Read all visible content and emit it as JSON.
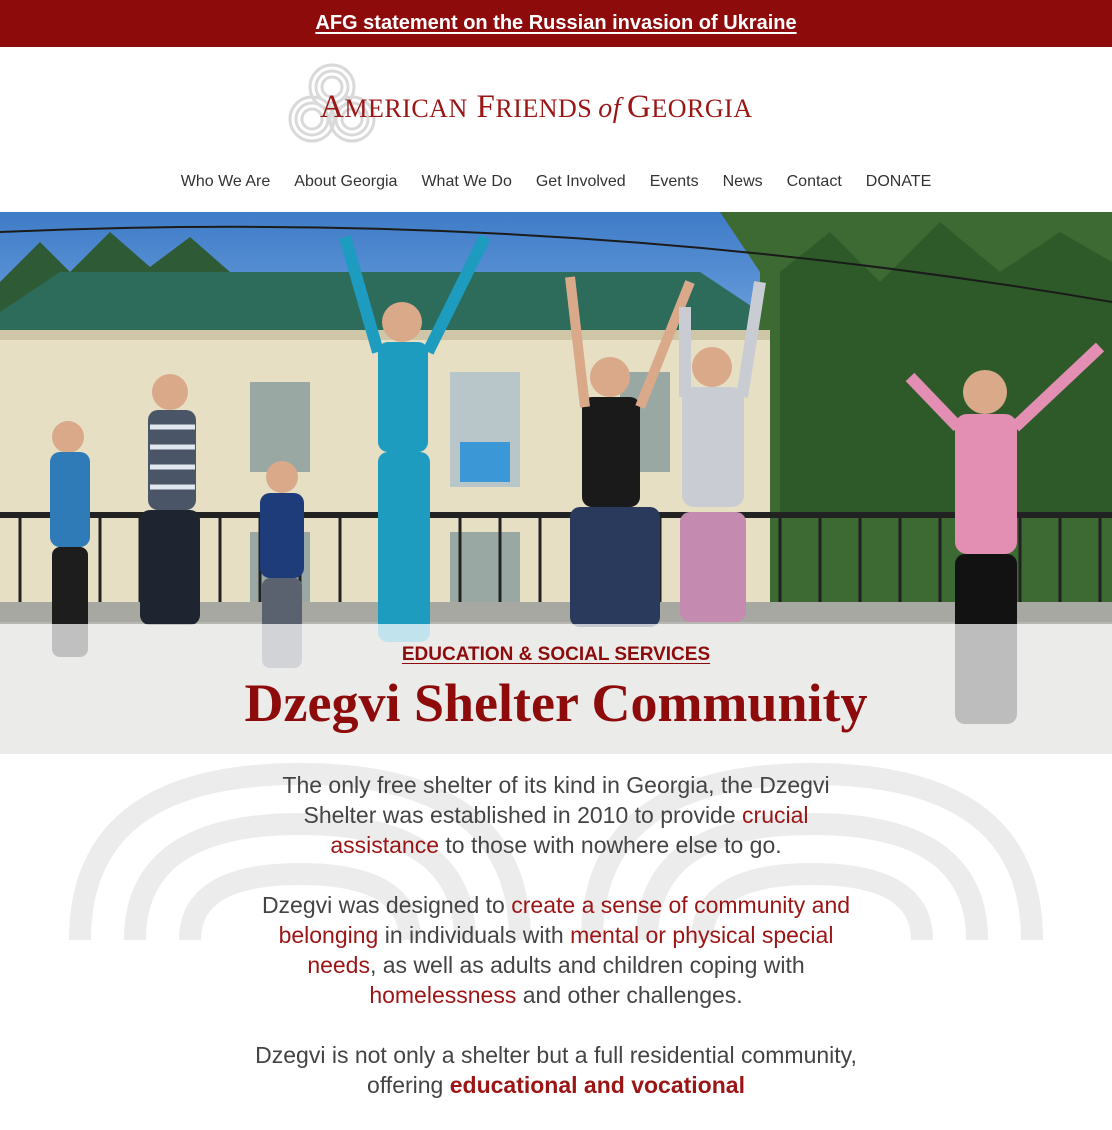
{
  "banner": {
    "link_text": "AFG statement on the Russian invasion of Ukraine"
  },
  "logo": {
    "icon": "knot-logo-icon",
    "word1_cap": "A",
    "word1_rest": "MERICAN",
    "word2_cap": "F",
    "word2_rest": "RIENDS",
    "of": "of",
    "word3_cap": "G",
    "word3_rest": "EORGIA"
  },
  "nav": {
    "items": [
      {
        "label": "Who We Are"
      },
      {
        "label": "About Georgia"
      },
      {
        "label": "What We Do"
      },
      {
        "label": "Get Involved"
      },
      {
        "label": "Events"
      },
      {
        "label": "News"
      },
      {
        "label": "Contact"
      },
      {
        "label": "DONATE"
      }
    ]
  },
  "hero": {
    "kicker": "EDUCATION & SOCIAL SERVICES",
    "title": "Dzegvi Shelter Community"
  },
  "content": {
    "p1": {
      "t1": "The only free shelter of its kind in Georgia, the Dzegvi Shelter was established in 2010 to provide ",
      "h1": "crucial assistance",
      "t2": " to those with nowhere else to go."
    },
    "p2": {
      "t1": "Dzegvi was designed to ",
      "h1": "create a sense of community and belonging",
      "t2": " in individuals with ",
      "h2": "mental or physical special needs",
      "t3": ", as well as adults and children coping with ",
      "h3": "homelessness",
      "t4": " and other challenges."
    },
    "p3": {
      "t1": "Dzegvi is not only a shelter but a full residential community, offering ",
      "h1": "educational and vocational"
    }
  },
  "colors": {
    "brand_red": "#8e0b0b",
    "accent_red": "#9b1515",
    "body_text": "#444444"
  }
}
